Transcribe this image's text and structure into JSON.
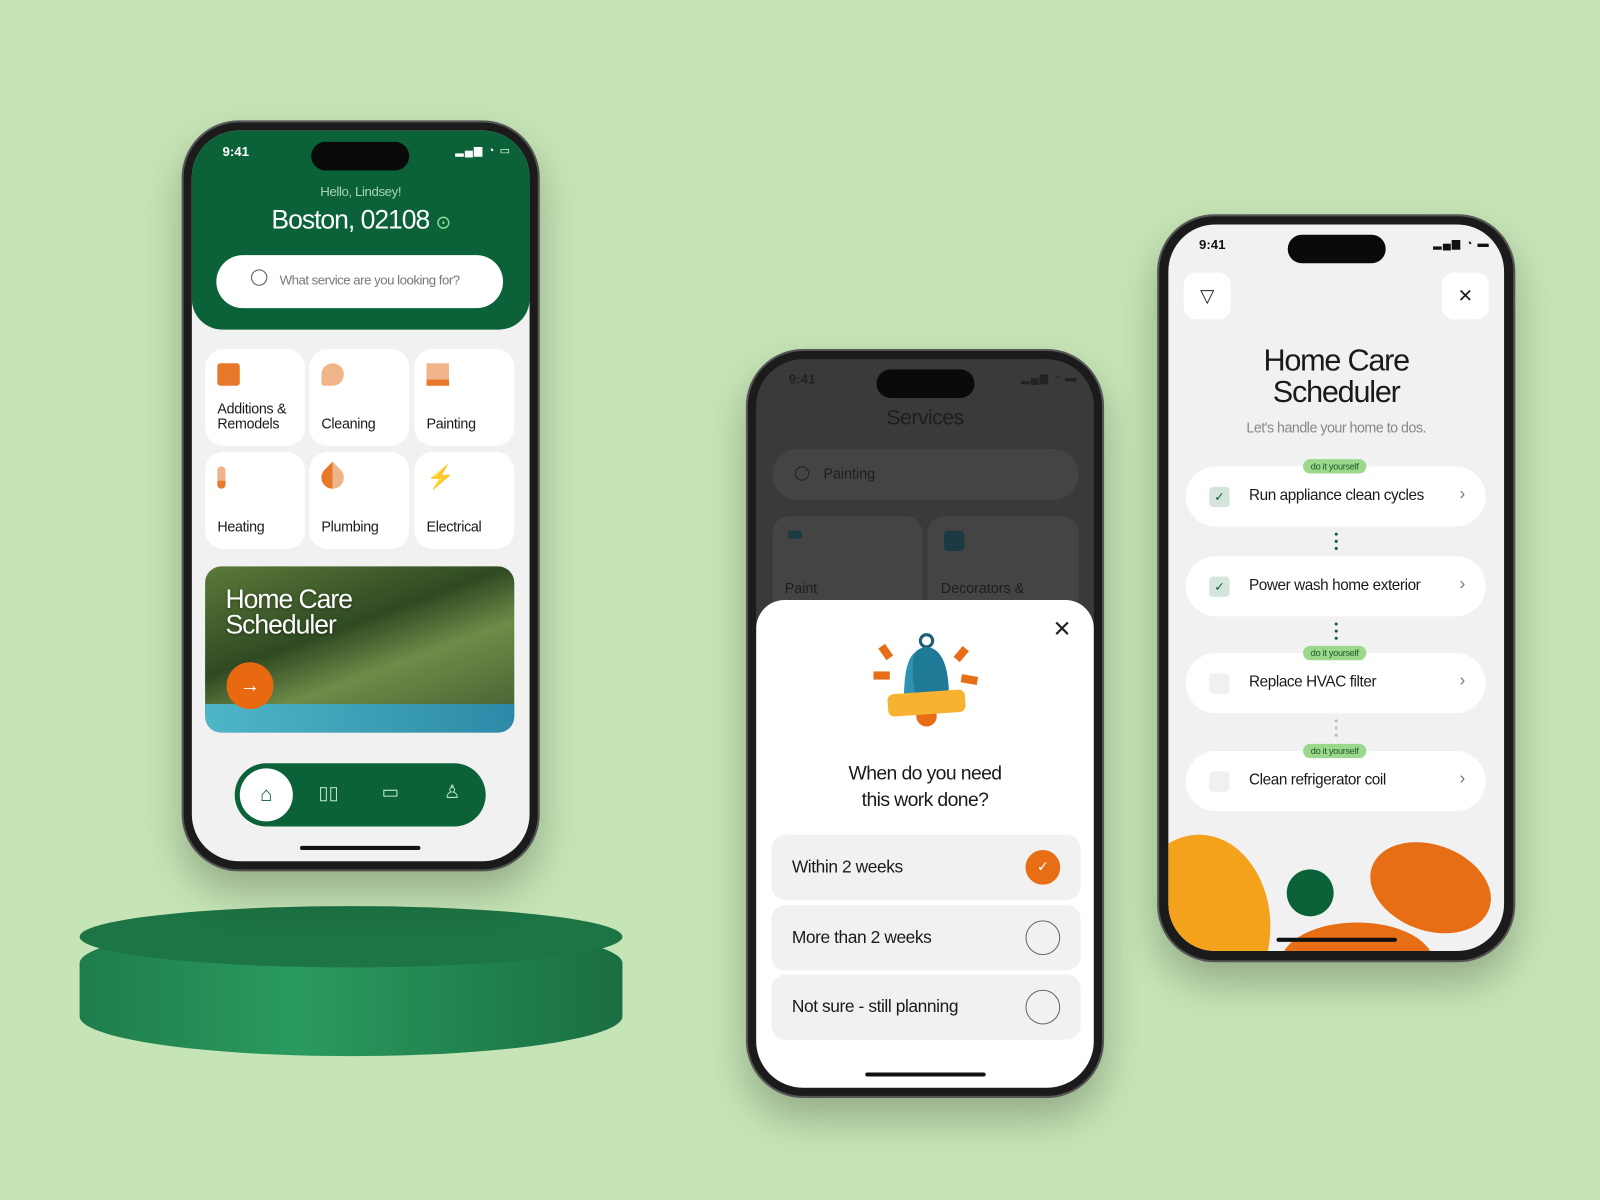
{
  "home": {
    "time": "9:41",
    "greeting": "Hello, Lindsey!",
    "location": "Boston, 02108",
    "search_placeholder": "What service are you looking for?",
    "categories": [
      {
        "label": "Additions & Remodels",
        "icon": "building-icon"
      },
      {
        "label": "Cleaning",
        "icon": "duster-icon"
      },
      {
        "label": "Painting",
        "icon": "paint-roller-icon"
      },
      {
        "label": "Heating",
        "icon": "thermometer-icon"
      },
      {
        "label": "Plumbing",
        "icon": "drop-icon"
      },
      {
        "label": "Electrical",
        "icon": "bolt-icon"
      }
    ],
    "banner": {
      "title_line1": "Home Care",
      "title_line2": "Scheduler"
    },
    "nav": [
      "home-icon",
      "services-icon",
      "calendar-icon",
      "profile-icon"
    ]
  },
  "services": {
    "time": "9:41",
    "title": "Services",
    "search_value": "Painting",
    "cards": [
      "Paint",
      "Decorators &"
    ],
    "modal": {
      "question_line1": "When do you need",
      "question_line2": "this work done?",
      "options": [
        {
          "label": "Within 2 weeks",
          "selected": true
        },
        {
          "label": "More than 2 weeks",
          "selected": false
        },
        {
          "label": "Not sure - still planning",
          "selected": false
        }
      ]
    }
  },
  "scheduler": {
    "time": "9:41",
    "title_line1": "Home Care",
    "title_line2": "Scheduler",
    "subtitle": "Let's handle your home to dos.",
    "badge": "do it yourself",
    "tasks": [
      {
        "label": "Run appliance clean cycles",
        "done": true,
        "diy": true
      },
      {
        "label": "Power wash home exterior",
        "done": true,
        "diy": false
      },
      {
        "label": "Replace HVAC filter",
        "done": false,
        "diy": true
      },
      {
        "label": "Clean refrigerator coil",
        "done": false,
        "diy": true
      }
    ]
  },
  "colors": {
    "brand_green": "#0b6238",
    "accent_orange": "#e86e16",
    "background": "#c6e5b6"
  }
}
